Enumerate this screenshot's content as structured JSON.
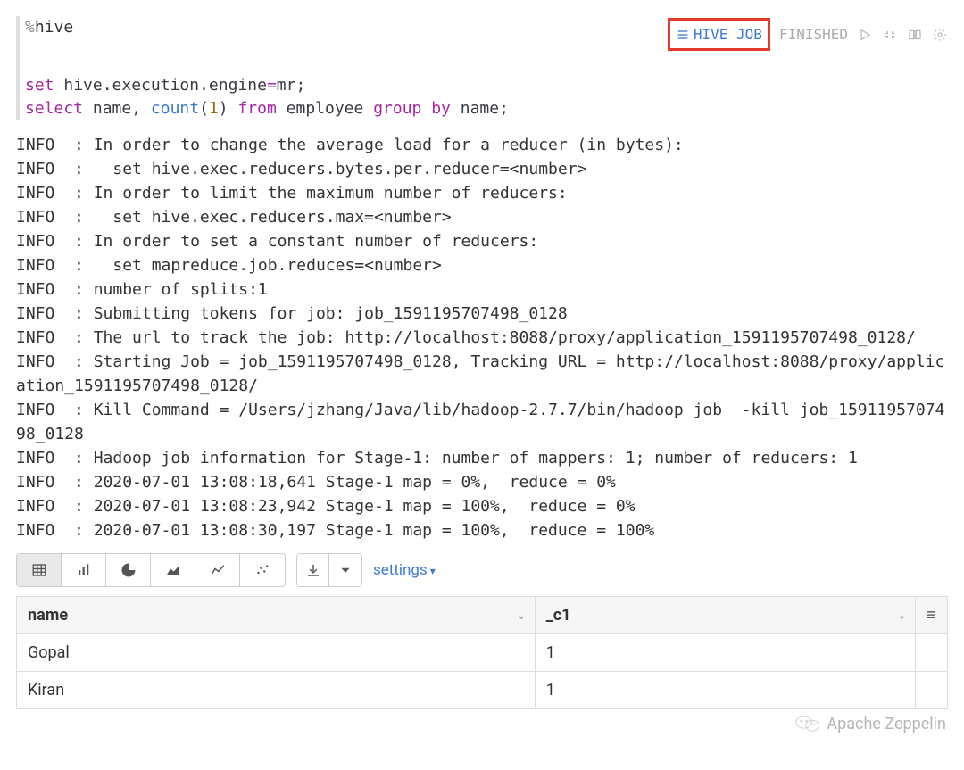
{
  "interpreter": {
    "prefix": "%",
    "name": "hive"
  },
  "code_lines": [
    [
      {
        "t": "set",
        "c": "kw-purple"
      },
      {
        "t": " ",
        "c": "ident"
      },
      {
        "t": "hive.execution.engine",
        "c": "ident"
      },
      {
        "t": "=",
        "c": "kw-purple"
      },
      {
        "t": "mr",
        "c": "ident"
      },
      {
        "t": ";",
        "c": "semi"
      }
    ],
    [
      {
        "t": "select",
        "c": "kw-purple"
      },
      {
        "t": " name, ",
        "c": "ident"
      },
      {
        "t": "count",
        "c": "kw-blue"
      },
      {
        "t": "(",
        "c": "paren"
      },
      {
        "t": "1",
        "c": "literal"
      },
      {
        "t": ")",
        "c": "paren"
      },
      {
        "t": " ",
        "c": "ident"
      },
      {
        "t": "from",
        "c": "kw-purple"
      },
      {
        "t": " employee ",
        "c": "ident"
      },
      {
        "t": "group",
        "c": "kw-purple"
      },
      {
        "t": " ",
        "c": "ident"
      },
      {
        "t": "by",
        "c": "kw-purple"
      },
      {
        "t": " name;",
        "c": "ident"
      }
    ]
  ],
  "job_link_label": "HIVE JOB",
  "status": "FINISHED",
  "log": "INFO  : In order to change the average load for a reducer (in bytes):\nINFO  :   set hive.exec.reducers.bytes.per.reducer=<number>\nINFO  : In order to limit the maximum number of reducers:\nINFO  :   set hive.exec.reducers.max=<number>\nINFO  : In order to set a constant number of reducers:\nINFO  :   set mapreduce.job.reduces=<number>\nINFO  : number of splits:1\nINFO  : Submitting tokens for job: job_1591195707498_0128\nINFO  : The url to track the job: http://localhost:8088/proxy/application_1591195707498_0128/\nINFO  : Starting Job = job_1591195707498_0128, Tracking URL = http://localhost:8088/proxy/application_1591195707498_0128/\nINFO  : Kill Command = /Users/jzhang/Java/lib/hadoop-2.7.7/bin/hadoop job  -kill job_1591195707498_0128\nINFO  : Hadoop job information for Stage-1: number of mappers: 1; number of reducers: 1\nINFO  : 2020-07-01 13:08:18,641 Stage-1 map = 0%,  reduce = 0%\nINFO  : 2020-07-01 13:08:23,942 Stage-1 map = 100%,  reduce = 0%\nINFO  : 2020-07-01 13:08:30,197 Stage-1 map = 100%,  reduce = 100%",
  "settings_label": "settings",
  "table": {
    "columns": [
      "name",
      "_c1"
    ],
    "rows": [
      [
        "Gopal",
        "1"
      ],
      [
        "Kiran",
        "1"
      ]
    ]
  },
  "watermark": "Apache Zeppelin"
}
